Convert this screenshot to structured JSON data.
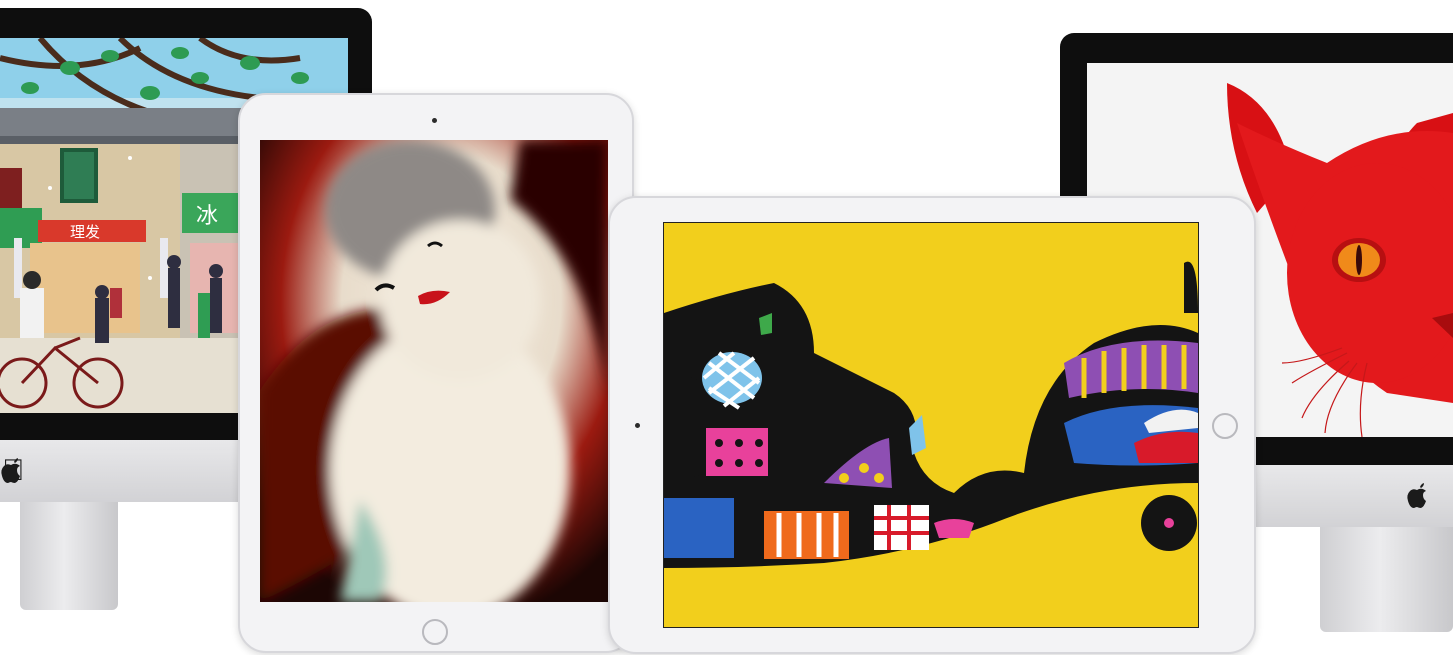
{
  "scene": {
    "description_tags": [
      "imac-left",
      "ipad-portrait",
      "ipad-landscape",
      "imac-right"
    ],
    "left_imac": {
      "shop_sign_left": "理发",
      "shop_sign_right": "冰",
      "logo_icon": "apple-logo-icon"
    },
    "right_imac": {
      "logo_icon": "apple-logo-icon",
      "accent": "#e0181b"
    },
    "portrait_ipad": {
      "accent": "#9b1a10"
    },
    "landscape_ipad": {
      "accent": "#f2cf1c"
    }
  }
}
